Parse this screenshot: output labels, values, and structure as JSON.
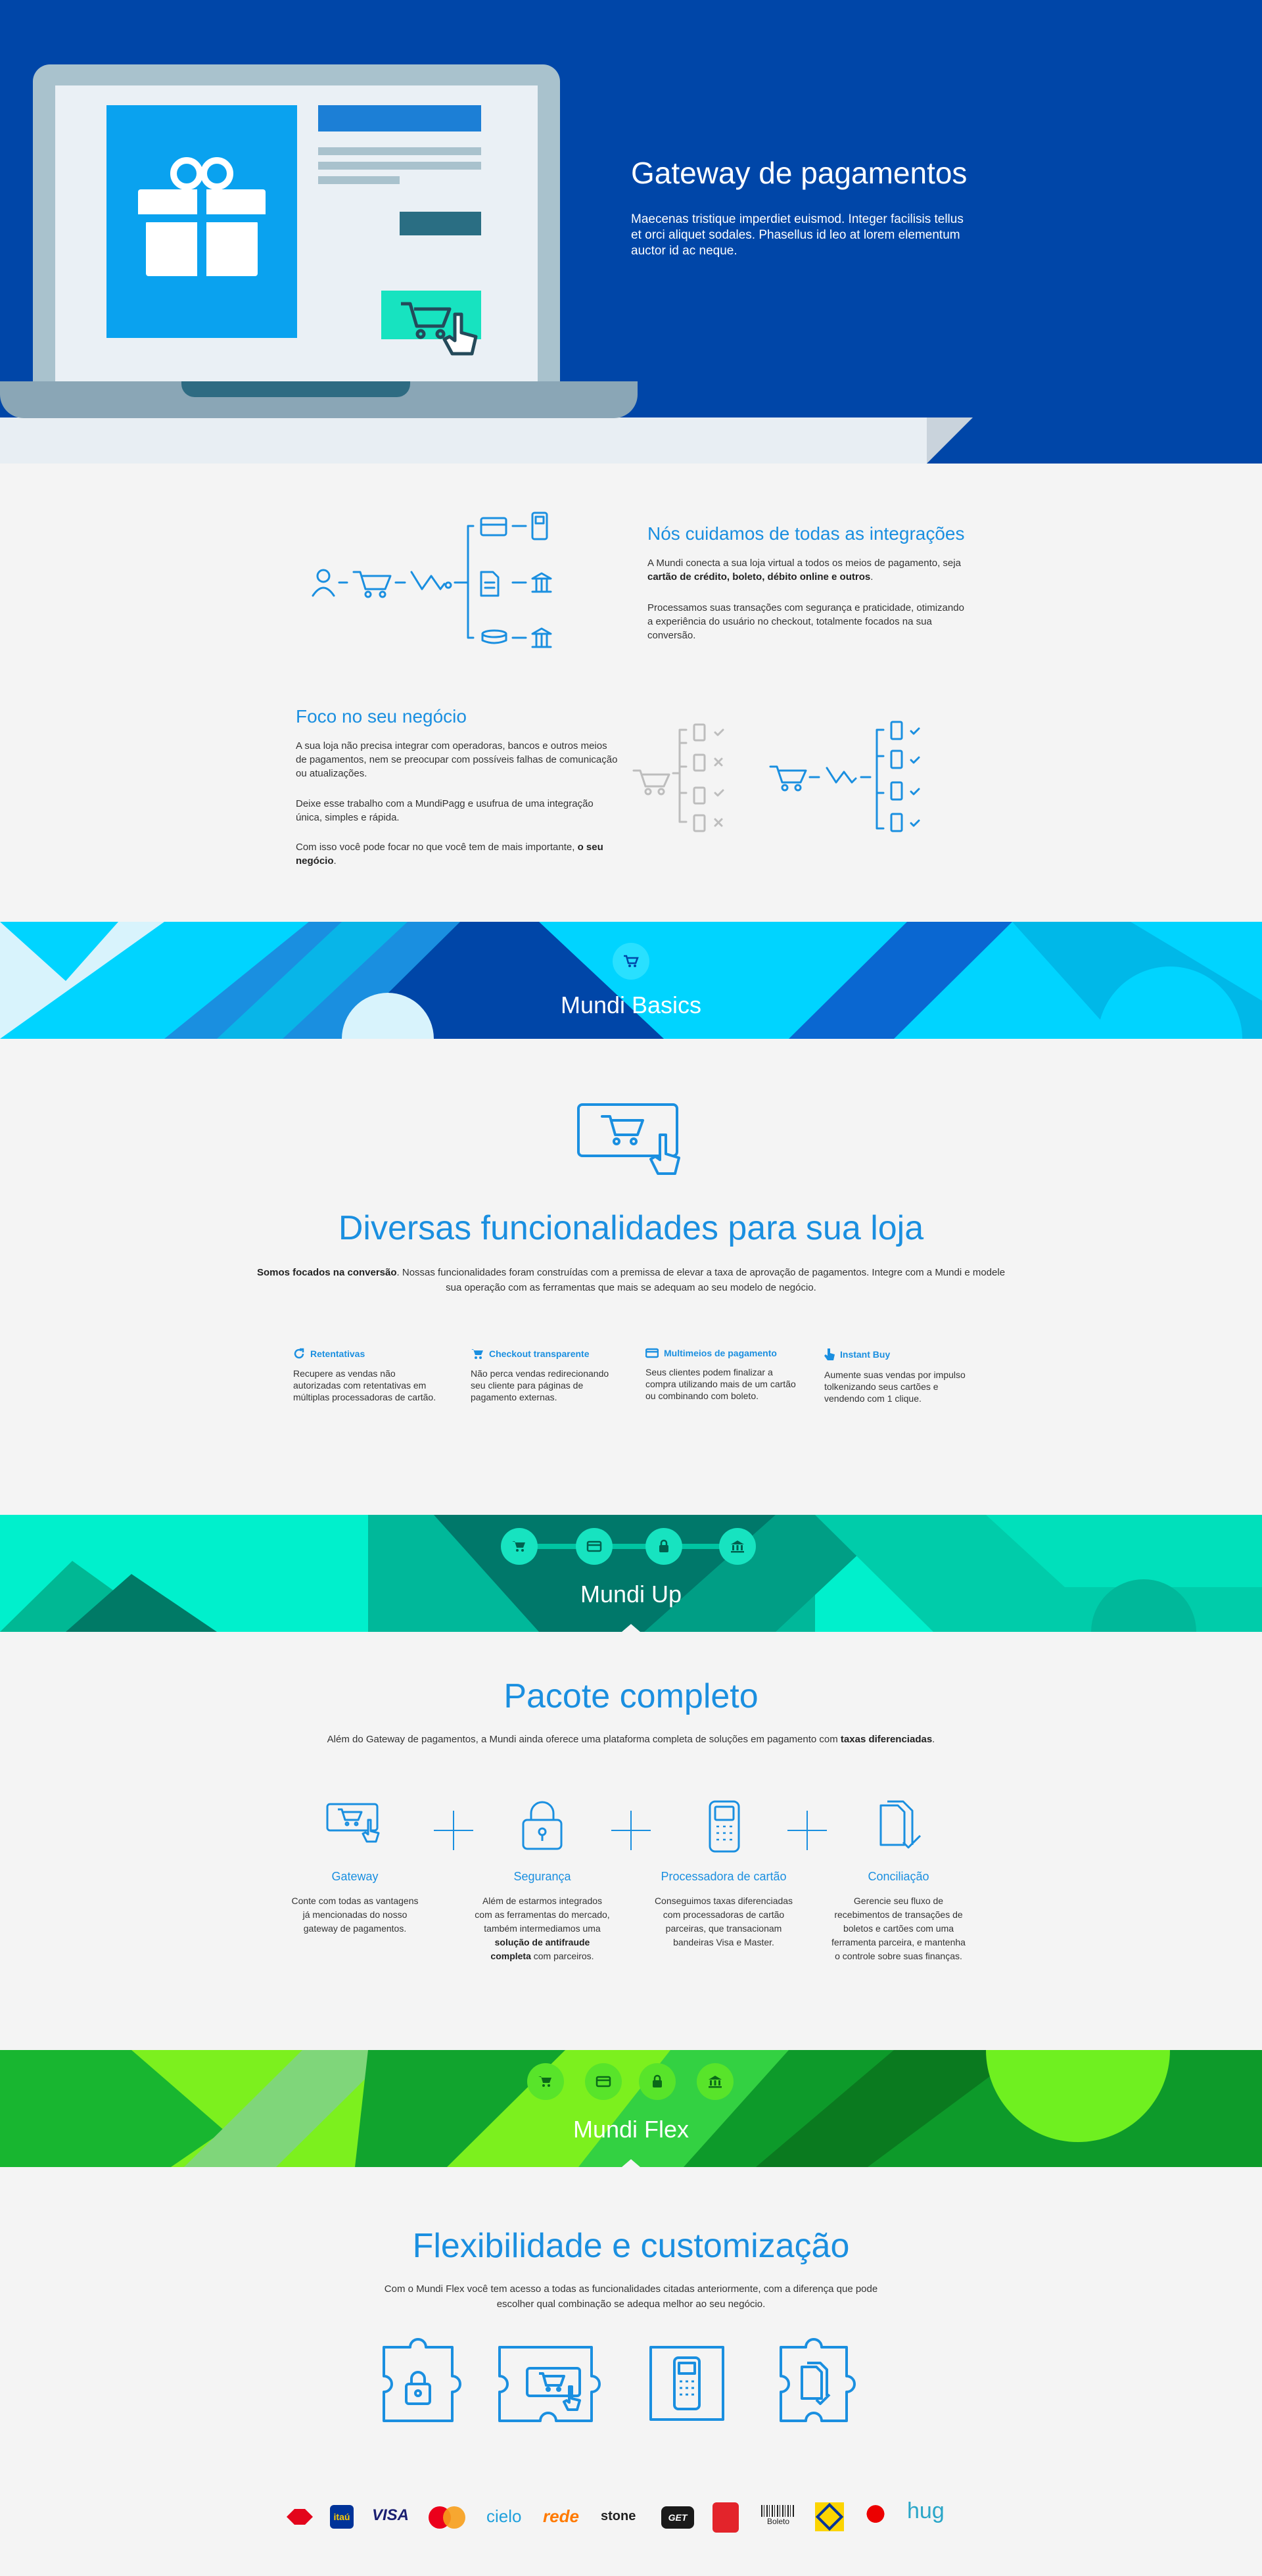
{
  "hero": {
    "title": "Gateway de pagamentos",
    "text": "Maecenas tristique imperdiet euismod. Integer facilisis tellus et orci aliquet sodales. Phasellus id leo at lorem elementum auctor id ac neque."
  },
  "integrations": {
    "title": "Nós cuidamos de todas as integrações",
    "p1_pre": "A Mundi conecta a sua loja virtual a todos os meios de pagamento, seja ",
    "p1_bold": "cartão de crédito, boleto, débito online e outros",
    "p1_post": ".",
    "p2": "Processamos suas transações com segurança e praticidade, otimizando a experiência do usuário no checkout, totalmente focados na sua conversão."
  },
  "focus": {
    "title": "Foco no seu negócio",
    "p1": "A sua loja não precisa integrar com operadoras, bancos e outros meios de pagamentos, nem se preocupar com possíveis falhas de comunicação ou atualizações.",
    "p2": "Deixe esse trabalho com a MundiPagg e usufrua de uma integração única, simples e rápida.",
    "p3_pre": "Com isso você pode focar no que você tem de mais importante, ",
    "p3_bold": "o seu negócio",
    "p3_post": "."
  },
  "basics": {
    "label": "Mundi Basics",
    "title": "Diversas funcionalidades para sua loja",
    "p_bold": "Somos focados na conversão",
    "p_rest": ". Nossas funcionalidades foram construídas com a premissa de elevar a taxa de aprovação de pagamentos. Integre com a Mundi e modele sua operação com as ferramentas que mais se adequam ao seu modelo de negócio.",
    "features": [
      {
        "title": "Retentativas",
        "text": "Recupere as vendas não autorizadas com retentativas em múltiplas processadoras de cartão."
      },
      {
        "title": "Checkout transparente",
        "text": "Não perca vendas redirecionando seu cliente para páginas de pagamento externas."
      },
      {
        "title": "Multimeios de pagamento",
        "text": "Seus clientes podem finalizar a compra utilizando mais de um cartão ou combinando com boleto."
      },
      {
        "title": "Instant Buy",
        "text": "Aumente suas vendas por impulso tolkenizando seus cartões e vendendo com 1 clique."
      }
    ]
  },
  "up": {
    "label": "Mundi Up",
    "title": "Pacote completo",
    "p_pre": "Além do Gateway de pagamentos, a Mundi ainda oferece uma plataforma completa de soluções em pagamento com ",
    "p_bold": "taxas diferenciadas",
    "p_post": ".",
    "items": [
      {
        "title": "Gateway",
        "text": "Conte com todas as vantagens já mencionadas do nosso gateway de pagamentos."
      },
      {
        "title": "Segurança",
        "text_pre": "Além de estarmos integrados com as ferramentas do mercado, também intermediamos uma ",
        "text_bold": "solução de antifraude completa",
        "text_post": " com parceiros."
      },
      {
        "title": "Processadora de cartão",
        "text": "Conseguimos taxas diferenciadas com processadoras de cartão parceiras, que transacionam bandeiras Visa e Master."
      },
      {
        "title": "Conciliação",
        "text": "Gerencie seu fluxo de recebimentos de transações de boletos e cartões com uma ferramenta parceira, e mantenha o controle sobre suas finanças."
      }
    ]
  },
  "flex": {
    "label": "Mundi Flex",
    "title": "Flexibilidade e customização",
    "p": "Com o Mundi Flex você tem acesso a todas as funcionalidades citadas anteriormente, com a diferença que pode escolher qual combinação se adequa melhor ao seu negócio."
  },
  "logos": [
    "itaú",
    "VISA",
    "cielo",
    "rede",
    "stone",
    "GET",
    "Boleto",
    "hug"
  ],
  "colors": {
    "brand_blue": "#0046a8",
    "accent_blue": "#1a8fe0",
    "teal": "#17e3c0",
    "green": "#23c43c"
  }
}
